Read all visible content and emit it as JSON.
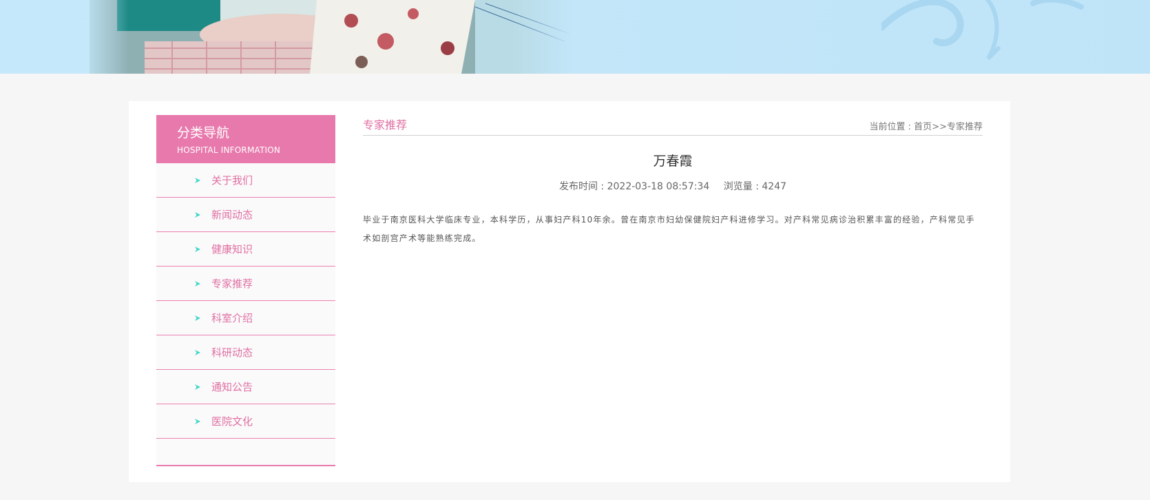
{
  "sidebar": {
    "title": "分类导航",
    "subtitle": "HOSPITAL INFORMATION",
    "items": [
      {
        "label": "关于我们"
      },
      {
        "label": "新闻动态"
      },
      {
        "label": "健康知识"
      },
      {
        "label": "专家推荐"
      },
      {
        "label": "科室介绍"
      },
      {
        "label": "科研动态"
      },
      {
        "label": "通知公告"
      },
      {
        "label": "医院文化"
      }
    ],
    "arrow_color": "#3fd6c8"
  },
  "content": {
    "section_title": "专家推荐",
    "breadcrumb": {
      "prefix": "当前位置 : ",
      "home": "首页",
      "separator": ">>",
      "current": "专家推荐"
    },
    "article": {
      "title": "万春霞",
      "publish_label": "发布时间 : ",
      "publish_time": "2022-03-18 08:57:34",
      "views_label": "浏览量 : ",
      "views": "4247",
      "body": "毕业于南京医科大学临床专业，本科学历，从事妇产科10年余。曾在南京市妇幼保健院妇产科进修学习。对产科常见病诊治积累丰富的经验，产科常见手术如剖宫产术等能熟练完成。"
    }
  },
  "colors": {
    "accent_pink": "#e879ac",
    "background": "#f6f6f6",
    "banner_blue": "#c4e7fa"
  }
}
